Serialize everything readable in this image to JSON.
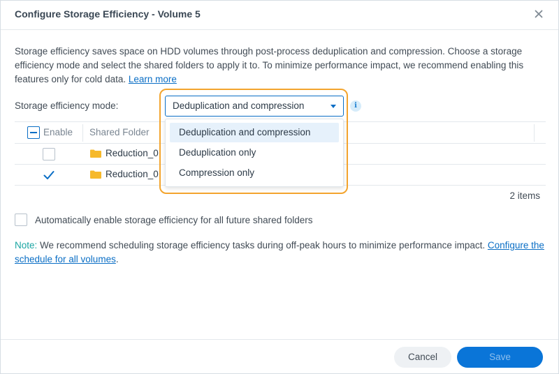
{
  "dialog": {
    "title": "Configure Storage Efficiency - Volume 5"
  },
  "description": {
    "text": "Storage efficiency saves space on HDD volumes through post-process deduplication and compression. Choose a storage efficiency mode and select the shared folders to apply it to. To minimize performance impact, we recommend enabling this features only for cold data.",
    "link": "Learn more"
  },
  "mode": {
    "label": "Storage efficiency mode:",
    "selected": "Deduplication and compression",
    "info_icon": "info-icon",
    "options": [
      {
        "label": "Deduplication and compression"
      },
      {
        "label": "Deduplication only"
      },
      {
        "label": "Compression only"
      }
    ]
  },
  "table": {
    "headers": {
      "enable": "Enable",
      "folder": "Shared Folder"
    },
    "rows": [
      {
        "enabled": false,
        "name": "Reduction_0"
      },
      {
        "enabled": true,
        "name": "Reduction_0"
      }
    ],
    "count": "2 items"
  },
  "auto_enable": {
    "label": "Automatically enable storage efficiency for all future shared folders",
    "checked": false
  },
  "note": {
    "prefix": "Note:",
    "text": "We recommend scheduling storage efficiency tasks during off-peak hours to minimize performance impact.",
    "link": "Configure the schedule for all volumes",
    "suffix": "."
  },
  "footer": {
    "cancel": "Cancel",
    "save": "Save"
  },
  "colors": {
    "accent": "#0a75d8",
    "highlight_frame": "#f3a42d",
    "note": "#1ba6a3",
    "folder": "#f6b92b"
  }
}
